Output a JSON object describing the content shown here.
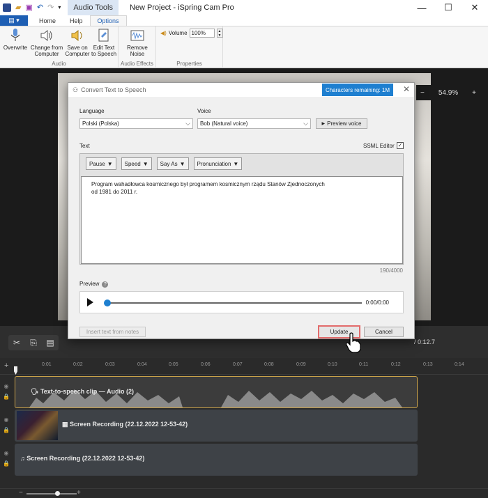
{
  "window": {
    "title": "New Project - iSpring Cam Pro",
    "context_tab": "Audio Tools",
    "controls": [
      "—",
      "☐",
      "✕"
    ]
  },
  "tabs": [
    {
      "label": "Home"
    },
    {
      "label": "Help"
    },
    {
      "label": "Options"
    }
  ],
  "ribbon": {
    "audio_group": {
      "label": "Audio",
      "buttons": [
        {
          "label": "Overwrite",
          "icon": "microphone-icon"
        },
        {
          "label": "Change from Computer",
          "icon": "speaker-icon"
        },
        {
          "label": "Save on Computer",
          "icon": "speaker-save-icon"
        },
        {
          "label": "Edit Text to Speech",
          "icon": "edit-document-icon"
        }
      ]
    },
    "effects_group": {
      "label": "Audio Effects",
      "buttons": [
        {
          "label": "Remove Noise",
          "icon": "noise-icon"
        }
      ]
    },
    "properties_group": {
      "label": "Properties",
      "volume_label": "Volume",
      "volume_value": "100%"
    }
  },
  "stage": {
    "zoom_minus": "−",
    "zoom_value": "54.9%",
    "zoom_plus": "+"
  },
  "timeline": {
    "time": "/ 0:12.7",
    "ticks": [
      "0:01",
      "0:02",
      "0:03",
      "0:04",
      "0:05",
      "0:06",
      "0:07",
      "0:08",
      "0:09",
      "0:10",
      "0:11",
      "0:12",
      "0:13",
      "0:14"
    ],
    "clips": [
      {
        "label": "Text-to-speech clip — Audio (2)"
      },
      {
        "label": "Screen Recording (22.12.2022 12-53-42)"
      },
      {
        "label": "Screen Recording (22.12.2022 12-53-42)"
      }
    ]
  },
  "dialog": {
    "title": "Convert Text to Speech",
    "chars_remaining": "Characters remaining: 1M",
    "language_label": "Language",
    "language_value": "Polski (Polska)",
    "voice_label": "Voice",
    "voice_value": "Bob (Natural voice)",
    "preview_voice": "Preview voice",
    "text_label": "Text",
    "ssml_label": "SSML Editor",
    "toolbar": [
      "Pause",
      "Speed",
      "Say As",
      "Pronunciation"
    ],
    "text": "Program wahadłowca kosmicznego był programem kosmicznym rządu Stanów Zjednoczonych\nod 1981 do 2011 r.",
    "counter": "190/4000",
    "preview_label": "Preview",
    "player_time": "0:00/0:00",
    "insert_notes": "Insert text from notes",
    "update": "Update",
    "cancel": "Cancel"
  }
}
